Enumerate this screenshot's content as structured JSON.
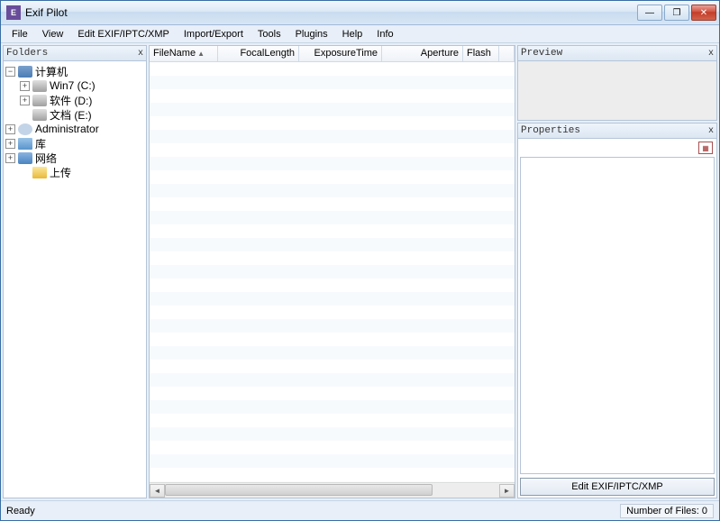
{
  "title": "Exif Pilot",
  "menu": [
    "File",
    "View",
    "Edit EXIF/IPTC/XMP",
    "Import/Export",
    "Tools",
    "Plugins",
    "Help",
    "Info"
  ],
  "panels": {
    "folders": "Folders",
    "preview": "Preview",
    "properties": "Properties"
  },
  "tree": {
    "computer": "计算机",
    "win7": "Win7 (C:)",
    "soft": "软件 (D:)",
    "docs": "文档 (E:)",
    "admin": "Administrator",
    "lib": "库",
    "net": "网络",
    "upload": "上传"
  },
  "columns": {
    "filename": "FileName",
    "focal": "FocalLength",
    "exposure": "ExposureTime",
    "aperture": "Aperture",
    "flash": "Flash"
  },
  "edit_button": "Edit EXIF/IPTC/XMP",
  "status": {
    "left": "Ready",
    "right": "Number of Files: 0"
  },
  "glyphs": {
    "close_x": "x",
    "minus": "−",
    "plus": "+",
    "max": "❐",
    "min": "—",
    "winclose": "✕",
    "sort": "▲",
    "left": "◄",
    "right": "►"
  }
}
